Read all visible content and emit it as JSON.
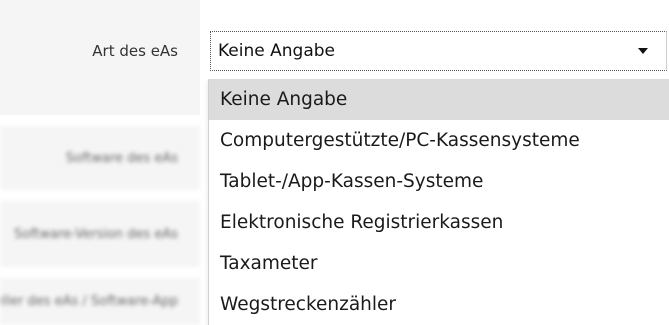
{
  "form": {
    "art_label": "Art des eAs",
    "blurred_labels": [
      "Software des eAs",
      "Software-Version des eAs",
      "Hersteller des eAs / Software-App"
    ]
  },
  "select": {
    "value": "Keine Angabe",
    "caret_icon": "triangle-down"
  },
  "dropdown": {
    "options": [
      "Keine Angabe",
      "Computergestützte/PC-Kassensysteme",
      "Tablet-/App-Kassen-Systeme",
      "Elektronische Registrierkassen",
      "Taxameter",
      "Wegstreckenzähler"
    ],
    "selected_index": 0,
    "highlight_color": "#dcdcdc"
  }
}
